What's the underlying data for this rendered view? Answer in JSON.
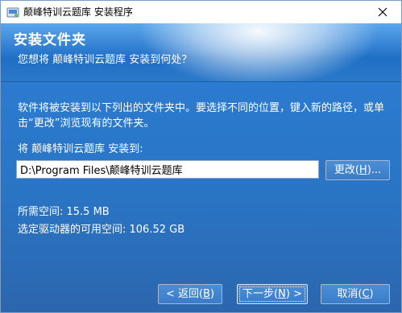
{
  "window": {
    "title": "颠峰特训云题库 安装程序",
    "app_icon": "installer-icon",
    "close_icon": "close-icon"
  },
  "header": {
    "title": "安装文件夹",
    "subtitle": "您想将 颠峰特训云题库 安装到何处？"
  },
  "body": {
    "instructions": "软件将被安装到以下列出的文件夹中。要选择不同的位置，键入新的路径，或单击“更改”浏览现有的文件夹。",
    "destination_label": "将 颠峰特训云题库 安装到:",
    "destination_path": "D:\\Program Files\\颠峰特训云题库",
    "change_button": {
      "label": "更改(",
      "accel": "H",
      "suffix": ")..."
    },
    "required_space": "所需空间: 15.5 MB",
    "available_space": "选定驱动器的可用空间: 106.52 GB"
  },
  "footer": {
    "back_button": {
      "label": "< 返回(",
      "accel": "B",
      "suffix": ")"
    },
    "next_button": {
      "label": "下一步(",
      "accel": "N",
      "suffix": ") >"
    },
    "cancel_button": {
      "label": "取消(",
      "accel": "C",
      "suffix": ")"
    }
  },
  "colors": {
    "background": "#2a78c8",
    "header_glow": "#ffffff",
    "text": "#ffffff"
  }
}
